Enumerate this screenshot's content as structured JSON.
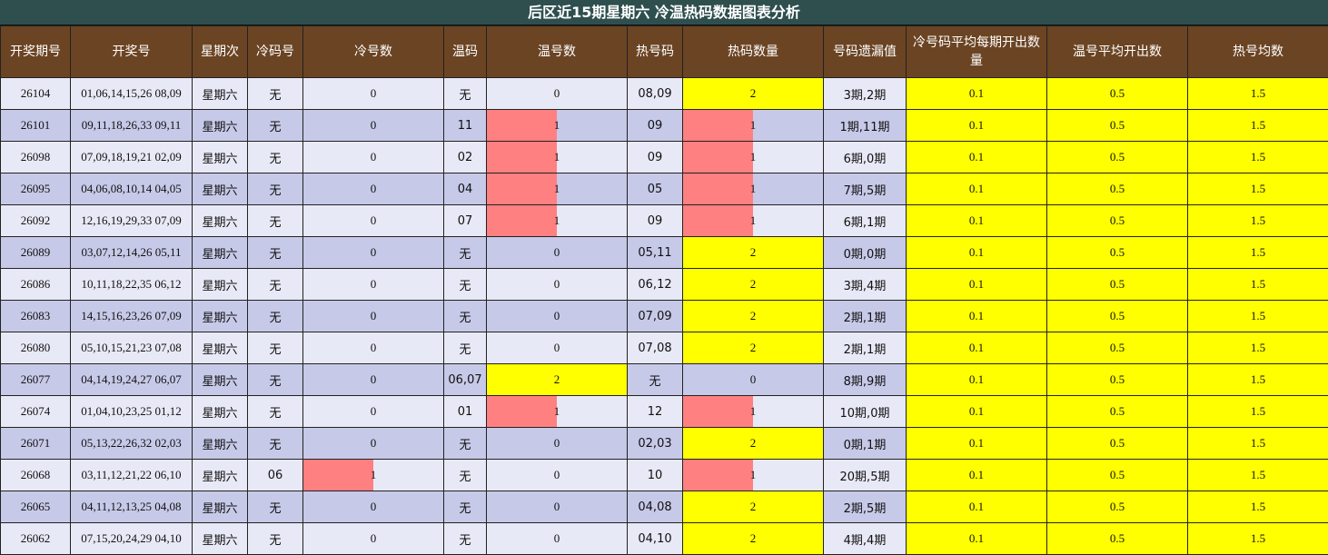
{
  "title": "后区近15期星期六 冷温热码数据图表分析",
  "headers": [
    "开奖期号",
    "开奖号",
    "星期次",
    "冷码号",
    "冷号数",
    "温码",
    "温号数",
    "热号码",
    "热码数量",
    "号码遗漏值",
    "冷号码平均每期开出数量",
    "温号平均开出数",
    "热号均数"
  ],
  "rows": [
    {
      "issue": "26104",
      "numbers": "01,06,14,15,26 08,09",
      "weekday": "星期六",
      "cold": "无",
      "cold_count": "0",
      "warm": "无",
      "warm_count": "0",
      "hot": "08,09",
      "hot_count": "2",
      "miss": "3期,2期",
      "cold_avg": "0.1",
      "warm_avg": "0.5",
      "hot_avg": "1.5"
    },
    {
      "issue": "26101",
      "numbers": "09,11,18,26,33 09,11",
      "weekday": "星期六",
      "cold": "无",
      "cold_count": "0",
      "warm": "11",
      "warm_count": "1",
      "hot": "09",
      "hot_count": "1",
      "miss": "1期,11期",
      "cold_avg": "0.1",
      "warm_avg": "0.5",
      "hot_avg": "1.5"
    },
    {
      "issue": "26098",
      "numbers": "07,09,18,19,21 02,09",
      "weekday": "星期六",
      "cold": "无",
      "cold_count": "0",
      "warm": "02",
      "warm_count": "1",
      "hot": "09",
      "hot_count": "1",
      "miss": "6期,0期",
      "cold_avg": "0.1",
      "warm_avg": "0.5",
      "hot_avg": "1.5"
    },
    {
      "issue": "26095",
      "numbers": "04,06,08,10,14 04,05",
      "weekday": "星期六",
      "cold": "无",
      "cold_count": "0",
      "warm": "04",
      "warm_count": "1",
      "hot": "05",
      "hot_count": "1",
      "miss": "7期,5期",
      "cold_avg": "0.1",
      "warm_avg": "0.5",
      "hot_avg": "1.5"
    },
    {
      "issue": "26092",
      "numbers": "12,16,19,29,33 07,09",
      "weekday": "星期六",
      "cold": "无",
      "cold_count": "0",
      "warm": "07",
      "warm_count": "1",
      "hot": "09",
      "hot_count": "1",
      "miss": "6期,1期",
      "cold_avg": "0.1",
      "warm_avg": "0.5",
      "hot_avg": "1.5"
    },
    {
      "issue": "26089",
      "numbers": "03,07,12,14,26 05,11",
      "weekday": "星期六",
      "cold": "无",
      "cold_count": "0",
      "warm": "无",
      "warm_count": "0",
      "hot": "05,11",
      "hot_count": "2",
      "miss": "0期,0期",
      "cold_avg": "0.1",
      "warm_avg": "0.5",
      "hot_avg": "1.5"
    },
    {
      "issue": "26086",
      "numbers": "10,11,18,22,35 06,12",
      "weekday": "星期六",
      "cold": "无",
      "cold_count": "0",
      "warm": "无",
      "warm_count": "0",
      "hot": "06,12",
      "hot_count": "2",
      "miss": "3期,4期",
      "cold_avg": "0.1",
      "warm_avg": "0.5",
      "hot_avg": "1.5"
    },
    {
      "issue": "26083",
      "numbers": "14,15,16,23,26 07,09",
      "weekday": "星期六",
      "cold": "无",
      "cold_count": "0",
      "warm": "无",
      "warm_count": "0",
      "hot": "07,09",
      "hot_count": "2",
      "miss": "2期,1期",
      "cold_avg": "0.1",
      "warm_avg": "0.5",
      "hot_avg": "1.5"
    },
    {
      "issue": "26080",
      "numbers": "05,10,15,21,23 07,08",
      "weekday": "星期六",
      "cold": "无",
      "cold_count": "0",
      "warm": "无",
      "warm_count": "0",
      "hot": "07,08",
      "hot_count": "2",
      "miss": "2期,1期",
      "cold_avg": "0.1",
      "warm_avg": "0.5",
      "hot_avg": "1.5"
    },
    {
      "issue": "26077",
      "numbers": "04,14,19,24,27 06,07",
      "weekday": "星期六",
      "cold": "无",
      "cold_count": "0",
      "warm": "06,07",
      "warm_count": "2",
      "hot": "无",
      "hot_count": "0",
      "miss": "8期,9期",
      "cold_avg": "0.1",
      "warm_avg": "0.5",
      "hot_avg": "1.5"
    },
    {
      "issue": "26074",
      "numbers": "01,04,10,23,25 01,12",
      "weekday": "星期六",
      "cold": "无",
      "cold_count": "0",
      "warm": "01",
      "warm_count": "1",
      "hot": "12",
      "hot_count": "1",
      "miss": "10期,0期",
      "cold_avg": "0.1",
      "warm_avg": "0.5",
      "hot_avg": "1.5"
    },
    {
      "issue": "26071",
      "numbers": "05,13,22,26,32 02,03",
      "weekday": "星期六",
      "cold": "无",
      "cold_count": "0",
      "warm": "无",
      "warm_count": "0",
      "hot": "02,03",
      "hot_count": "2",
      "miss": "0期,1期",
      "cold_avg": "0.1",
      "warm_avg": "0.5",
      "hot_avg": "1.5"
    },
    {
      "issue": "26068",
      "numbers": "03,11,12,21,22 06,10",
      "weekday": "星期六",
      "cold": "06",
      "cold_count": "1",
      "warm": "无",
      "warm_count": "0",
      "hot": "10",
      "hot_count": "1",
      "miss": "20期,5期",
      "cold_avg": "0.1",
      "warm_avg": "0.5",
      "hot_avg": "1.5"
    },
    {
      "issue": "26065",
      "numbers": "04,11,12,13,25 04,08",
      "weekday": "星期六",
      "cold": "无",
      "cold_count": "0",
      "warm": "无",
      "warm_count": "0",
      "hot": "04,08",
      "hot_count": "2",
      "miss": "2期,5期",
      "cold_avg": "0.1",
      "warm_avg": "0.5",
      "hot_avg": "1.5"
    },
    {
      "issue": "26062",
      "numbers": "07,15,20,24,29 04,10",
      "weekday": "星期六",
      "cold": "无",
      "cold_count": "0",
      "warm": "无",
      "warm_count": "0",
      "hot": "04,10",
      "hot_count": "2",
      "miss": "4期,4期",
      "cold_avg": "0.1",
      "warm_avg": "0.5",
      "hot_avg": "1.5"
    }
  ],
  "colors": {
    "highlight_max": "#ffff00",
    "data_bar": "#ff8080",
    "header_bg": "#6b4423",
    "title_bg": "#2f4f4f",
    "row_light": "#e8e9f6",
    "row_dark": "#c7c9e8"
  }
}
